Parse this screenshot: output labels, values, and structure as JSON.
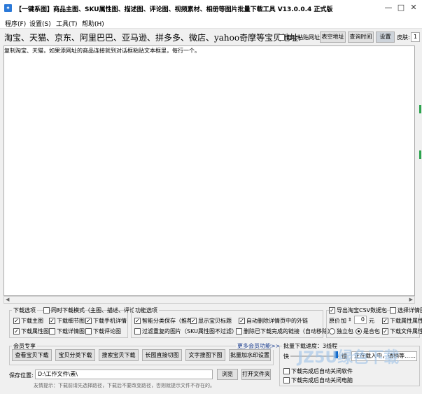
{
  "window": {
    "title": "【一键系图】商品主图、SKU属性图、描述图、评论图、视频素材、相册等图片批量下载工具 V13.0.0.4 正式版",
    "icon_name": "app-icon",
    "controls": [
      "minimize-icon",
      "maximize-icon",
      "close-icon"
    ]
  },
  "menu": [
    "程序(F)",
    "设置(S)",
    "工具(T)",
    "帮助(H)"
  ],
  "urlbar": {
    "platforms_label": "淘宝、天猫、京东、阿里巴巴、亚马逊、拼多多、微店、yahoo奇摩等宝贝地址:",
    "auto_paste_label": "自动粘贴网址",
    "btn_table_address": "表空地址",
    "btn_query_time": "查询时间",
    "btn_settings": "设置",
    "skin_label": "皮肤:",
    "skin_value": "1"
  },
  "main": {
    "placeholder_text": "复制淘宝、天猫，如果添网址的商品连接就到对话框粘贴文本框里，每行一个。"
  },
  "download_options": {
    "group_label": "下载选项",
    "sku_mode_label": "同时下载模式（主图、描述、评论）",
    "items": [
      {
        "label": "下载主图",
        "checked": true
      },
      {
        "label": "下载细节图",
        "checked": true
      },
      {
        "label": "下载手机详情",
        "checked": true
      },
      {
        "label": "下载属性图",
        "checked": true
      },
      {
        "label": "下载详情图",
        "checked": false
      },
      {
        "label": "下载评论图",
        "checked": false
      }
    ]
  },
  "function_options": {
    "group_label": "功能选项",
    "items": [
      {
        "label": "智能分类保存（推荐）",
        "checked": true
      },
      {
        "label": "显示宝贝标题",
        "checked": true
      },
      {
        "label": "自动删除详情页中的外链",
        "checked": true
      },
      {
        "label": "过滤重复的图片（SKU属性图不过滤）",
        "checked": false
      },
      {
        "label": "删除已下载完成的链接（自动移除）",
        "checked": false
      }
    ]
  },
  "export_options": {
    "export_csv_label": "导出淘宝CSV数据包",
    "export_csv_checked": true,
    "batch_detail_label": "选择详情图",
    "batch_detail_checked": false,
    "price_label": "原价",
    "price_op": "加",
    "price_value": "0",
    "price_unit": "元",
    "attr_label": "下载属性属性",
    "attr_checked": true,
    "radio_independent": "独立包",
    "radio_merged": "是合包",
    "radio_merged_on": true,
    "merge_image_label": "下载文件属性",
    "merge_image_checked": true
  },
  "more_features": {
    "group_label": "会员专享",
    "more_link": "更多会员功能>>",
    "buttons": [
      "查看宝贝下载",
      "宝贝分类下载",
      "搜索宝贝下载",
      "长图直接切图",
      "文字搜图下图",
      "批量加水印设置"
    ]
  },
  "batch_speed": {
    "group_label": "批量下载速度：3线程",
    "fast": "快",
    "slow": "慢",
    "status": "正在载入中，请稍等……",
    "after_done_1": "下载完成后自动关闭软件",
    "after_done_2": "下载完成后自动关闭电脑"
  },
  "save_path": {
    "label": "保存位置:",
    "value": "D:\\工作文件\\素\\",
    "browse_button": "浏览",
    "open_folder_button": "打开文件夹"
  },
  "hint": "友情提示：下载前请先选择路径，下载后不要改变路径，否则就提示文件不存在的。",
  "watermark": "JZ5U绿色下载"
}
